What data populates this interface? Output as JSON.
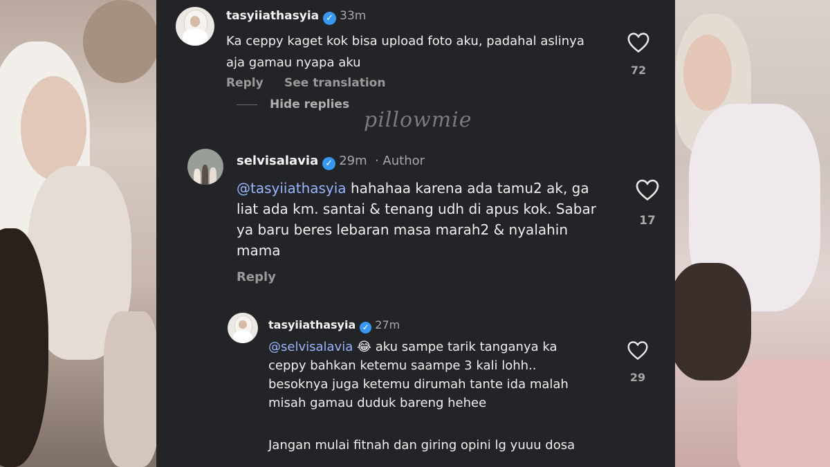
{
  "watermark": "pillowmie",
  "comments": [
    {
      "username": "tasyiiathasyia",
      "time": "33m",
      "text": "Ka ceppy kaget kok bisa upload foto aku, padahal aslinya aja gamau nyapa aku",
      "likes": "72",
      "reply_label": "Reply",
      "translate_label": "See translation",
      "hide_replies_label": "Hide replies"
    },
    {
      "username": "selvisalavia",
      "time": "29m",
      "author_label": "· Author",
      "mention": "@tasyiiathasyia",
      "text": "hahahaa karena ada tamu2 ak, ga liat ada km. santai & tenang udh di apus kok. Sabar ya baru beres lebaran masa marah2 & nyalahin mama",
      "likes": "17",
      "reply_label": "Reply"
    },
    {
      "username": "tasyiiathasyia",
      "time": "27m",
      "mention": "@selvisalavia",
      "emoji": "😂",
      "text": "aku sampe tarik tanganya ka ceppy bahkan ketemu saampe 3 kali lohh.. besoknya juga ketemu dirumah tante ida malah misah gamau duduk bareng hehee",
      "text2": "Jangan mulai fitnah dan giring opini lg yuuu dosa",
      "likes": "29"
    }
  ]
}
